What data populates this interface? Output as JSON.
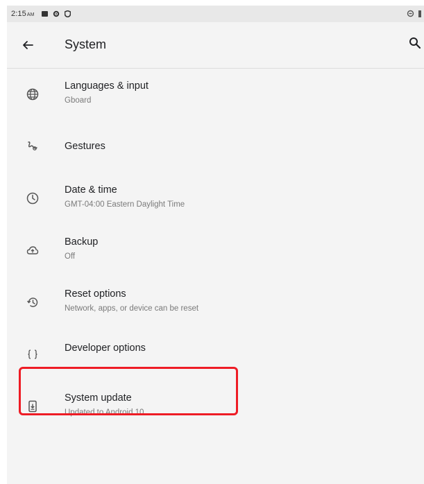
{
  "status_bar": {
    "time": "2:15",
    "ampm": "AM"
  },
  "app_bar": {
    "title": "System"
  },
  "items": [
    {
      "label": "Languages & input",
      "summary": "Gboard",
      "icon": "globe-icon"
    },
    {
      "label": "Gestures",
      "summary": "",
      "icon": "gesture-icon"
    },
    {
      "label": "Date & time",
      "summary": "GMT-04:00 Eastern Daylight Time",
      "icon": "clock-icon"
    },
    {
      "label": "Backup",
      "summary": "Off",
      "icon": "cloud-upload-icon"
    },
    {
      "label": "Reset options",
      "summary": "Network, apps, or device can be reset",
      "icon": "history-icon"
    },
    {
      "label": "Developer options",
      "summary": "",
      "icon": "braces-icon"
    },
    {
      "label": "System update",
      "summary": "Updated to Android 10",
      "icon": "system-update-icon"
    }
  ],
  "colors": {
    "highlight": "#ee1c25",
    "background": "#f4f4f4"
  }
}
